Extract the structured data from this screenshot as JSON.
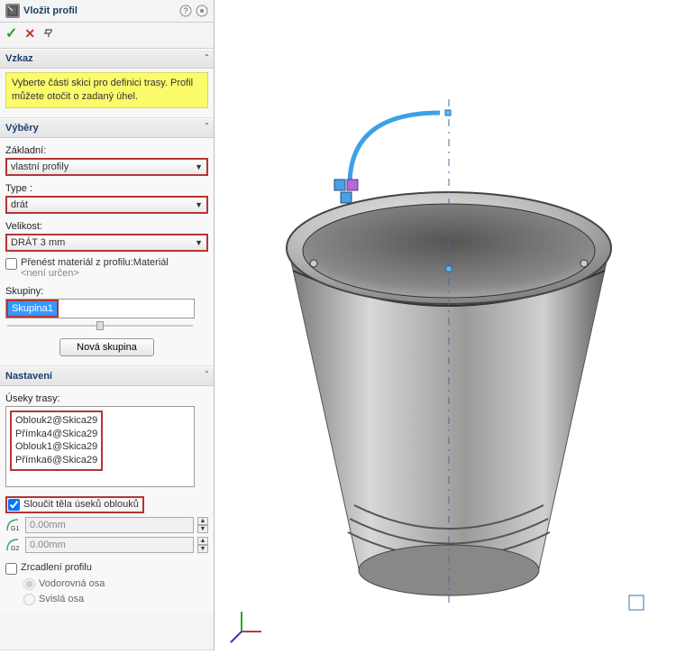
{
  "title": "Vložit profil",
  "message": "Vyberte části skici pro definici trasy. Profil můžete otočit o zadaný úhel.",
  "sections": {
    "vzkaz": "Vzkaz",
    "vybery": "Výběry",
    "nastaveni": "Nastavení"
  },
  "vybery": {
    "zakladni_label": "Základní:",
    "zakladni_value": "vlastní profily",
    "type_label": "Type :",
    "type_value": "drát",
    "velikost_label": "Velikost:",
    "velikost_value": "DRÁT 3 mm",
    "prenest_label": "Přenést materiál z profilu:Materiál",
    "prenest_sub": "<není určen>",
    "skupiny_label": "Skupiny:",
    "skupina_sel": "Skupina1",
    "nova_skupina": "Nová skupina"
  },
  "nastaveni": {
    "useky_label": "Úseky trasy:",
    "useky": [
      "Oblouk2@Skica29",
      "Přímka4@Skica29",
      "Oblouk1@Skica29",
      "Přímka6@Skica29"
    ],
    "sloucit_label": "Sloučit těla úseků oblouků",
    "g1_value": "0.00mm",
    "g2_value": "0.00mm",
    "zrcadleni_label": "Zrcadlení profilu",
    "vodorovna": "Vodorovná osa",
    "svisla": "Svislá osa"
  }
}
